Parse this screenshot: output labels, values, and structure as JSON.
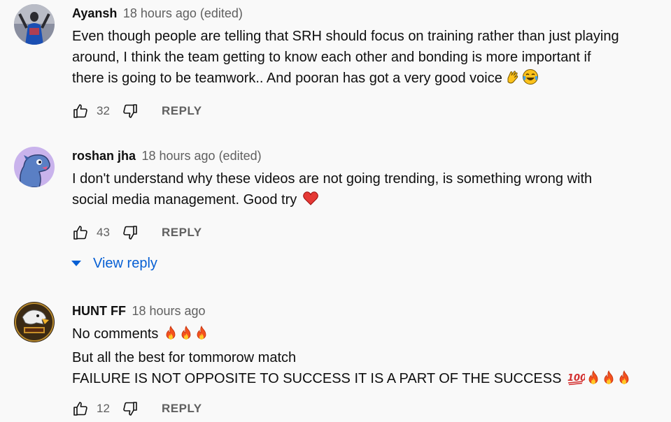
{
  "comments": [
    {
      "author": "Ayansh",
      "time": "18 hours ago (edited)",
      "lines": [
        "Even though people are telling that SRH should focus on training rather than just playing",
        "around, I think the team getting to know each other and bonding is more important if",
        "there is going to be teamwork.. And pooran has got a very good voice"
      ],
      "emojis_line3": [
        "clapping-hands-emoji",
        "tears-of-joy-emoji"
      ],
      "likes": "32",
      "reply_label": "REPLY"
    },
    {
      "author": "roshan jha",
      "time": "18 hours ago (edited)",
      "lines": [
        "I don't understand why these videos are not going trending, is something wrong with",
        "social media management. Good try"
      ],
      "emojis_line2": [
        "red-heart-emoji"
      ],
      "likes": "43",
      "reply_label": "REPLY",
      "view_reply": "View reply"
    },
    {
      "author": "HUNT FF",
      "time": "18 hours ago",
      "lines": [
        "No comments",
        "But all the best for tommorow match",
        "FAILURE IS NOT OPPOSITE TO SUCCESS IT IS A PART OF THE SUCCESS"
      ],
      "emojis_line1": [
        "fire-emoji",
        "fire-emoji",
        "fire-emoji"
      ],
      "emojis_line3": [
        "hundred-points-emoji",
        "fire-emoji",
        "fire-emoji",
        "fire-emoji"
      ],
      "likes": "12",
      "reply_label": "REPLY"
    }
  ],
  "colors": {
    "background": "#f9f9f9",
    "text": "#0f0f0f",
    "secondary": "#606060",
    "link": "#065fd4"
  }
}
